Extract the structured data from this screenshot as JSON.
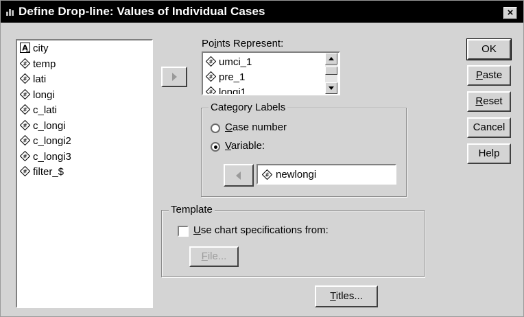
{
  "window": {
    "title": "Define Drop-line: Values of Individual Cases",
    "close_label": "×"
  },
  "variables": [
    {
      "name": "city",
      "type": "string",
      "icon": "string-variable-icon"
    },
    {
      "name": "temp",
      "type": "numeric",
      "icon": "numeric-variable-icon"
    },
    {
      "name": "lati",
      "type": "numeric",
      "icon": "numeric-variable-icon"
    },
    {
      "name": "longi",
      "type": "numeric",
      "icon": "numeric-variable-icon"
    },
    {
      "name": "c_lati",
      "type": "numeric",
      "icon": "numeric-variable-icon"
    },
    {
      "name": "c_longi",
      "type": "numeric",
      "icon": "numeric-variable-icon"
    },
    {
      "name": "c_longi2",
      "type": "numeric",
      "icon": "numeric-variable-icon"
    },
    {
      "name": "c_longi3",
      "type": "numeric",
      "icon": "numeric-variable-icon"
    },
    {
      "name": "filter_$",
      "type": "numeric",
      "icon": "numeric-variable-icon"
    }
  ],
  "points_represent": {
    "label": "Points Represent:",
    "items": [
      "umci_1",
      "pre_1",
      "longi1"
    ]
  },
  "category_labels": {
    "title": "Category Labels",
    "case_number_label": "Case number",
    "variable_label": "Variable:",
    "selected": "variable",
    "variable_value": "newlongi"
  },
  "template": {
    "title": "Template",
    "use_spec_label": "Use chart specifications from:",
    "use_spec_checked": false,
    "file_button": "File..."
  },
  "buttons": {
    "ok": "OK",
    "paste": "Paste",
    "reset": "Reset",
    "cancel": "Cancel",
    "help": "Help",
    "titles": "Titles..."
  },
  "colors": {
    "dialog_bg": "#d4d4d4",
    "titlebar_bg": "#000000",
    "titlebar_text": "#ffffff"
  }
}
